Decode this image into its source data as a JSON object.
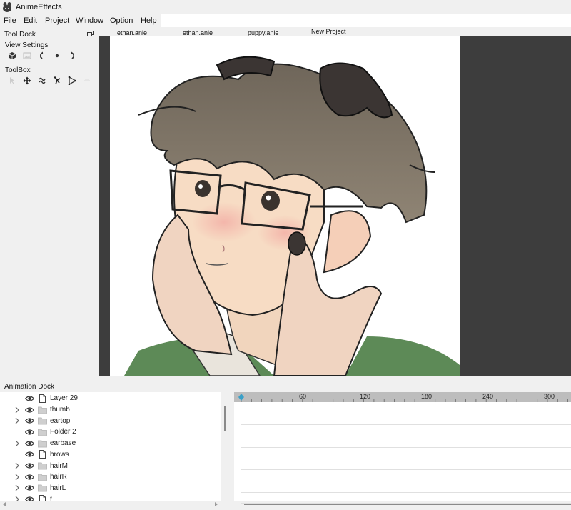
{
  "window": {
    "title": "AnimeEffects"
  },
  "menu": [
    "File",
    "Edit",
    "Project",
    "Window",
    "Option",
    "Help"
  ],
  "tool_dock": {
    "title": "Tool Dock",
    "view_settings_label": "View Settings",
    "view_icons": [
      "cube-icon",
      "image-icon",
      "rotate-left-icon",
      "dot-icon",
      "rotate-right-icon"
    ],
    "toolbox_label": "ToolBox",
    "tool_icons": [
      "cursor-icon",
      "move-icon",
      "bone-icon",
      "pose-icon",
      "mesh-icon",
      "other-icon"
    ]
  },
  "project_tabs": [
    "ethan.anie",
    "ethan.anie",
    "puppy.anie",
    "New Project"
  ],
  "animation_dock": {
    "title": "Animation Dock",
    "layers": [
      {
        "label": "Layer 29",
        "type": "file",
        "expandable": false
      },
      {
        "label": "thumb",
        "type": "folder",
        "expandable": true
      },
      {
        "label": "eartop",
        "type": "folder",
        "expandable": true
      },
      {
        "label": "Folder 2",
        "type": "folder",
        "expandable": false
      },
      {
        "label": "earbase",
        "type": "folder",
        "expandable": true
      },
      {
        "label": "brows",
        "type": "file",
        "expandable": false
      },
      {
        "label": "hairM",
        "type": "folder",
        "expandable": true
      },
      {
        "label": "hairR",
        "type": "folder",
        "expandable": true
      },
      {
        "label": "hairL",
        "type": "folder",
        "expandable": true
      },
      {
        "label": "f",
        "type": "file",
        "expandable": true
      }
    ],
    "ruler_labels": [
      "60",
      "120",
      "180",
      "240",
      "300"
    ]
  },
  "colors": {
    "viewport_bg": "#3d3d3d",
    "ruler_bg": "#bdbdbd",
    "playhead": "#3aa0c8"
  }
}
